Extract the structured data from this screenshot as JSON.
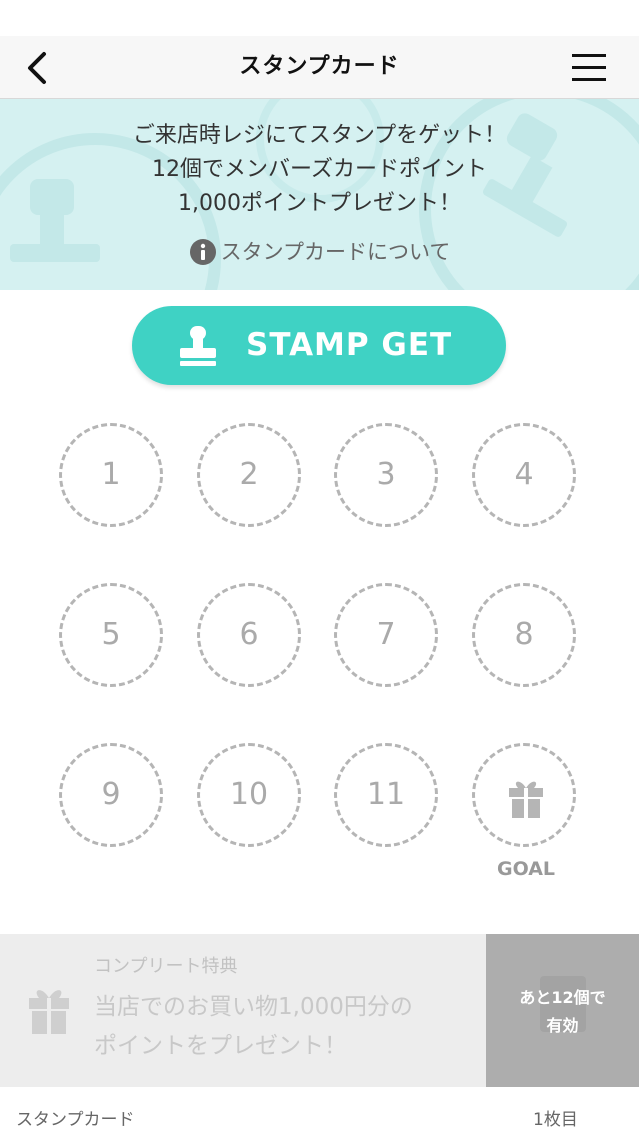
{
  "nav": {
    "title": "スタンプカード",
    "back_icon": "chevron-left-icon",
    "menu_icon": "hamburger-menu-icon"
  },
  "banner": {
    "lines": [
      "ご来店時レジにてスタンプをゲット！",
      "12個でメンバーズカードポイント",
      "1,000ポイントプレゼント！"
    ],
    "about_label": "スタンプカードについて",
    "about_icon": "info-icon",
    "background": "#d5f1f1"
  },
  "stamp_button": {
    "label": "STAMP GET",
    "icon": "stamp-icon",
    "color": "#3fd2c4"
  },
  "card": {
    "slots": [
      "1",
      "2",
      "3",
      "4",
      "5",
      "6",
      "7",
      "8",
      "9",
      "10",
      "11"
    ],
    "goal_label": "GOAL",
    "goal_icon": "gift-icon"
  },
  "complete": {
    "heading": "コンプリート特典",
    "body_lines": [
      "当店でのお買い物1,000円分の",
      "ポイントをプレゼント！"
    ],
    "icon": "gift-icon",
    "remaining_lines": [
      "あと12個で",
      "有効"
    ]
  },
  "footer": {
    "label": "スタンプカード",
    "count": "1枚目"
  }
}
